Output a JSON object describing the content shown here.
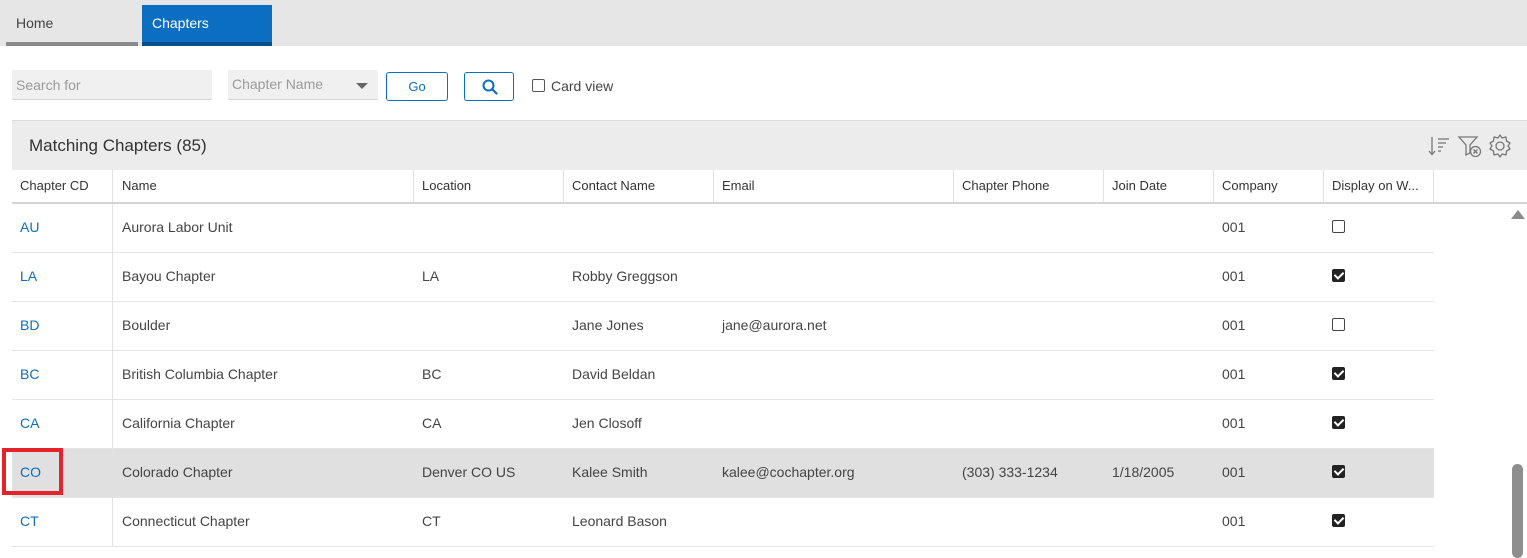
{
  "tabs": [
    {
      "label": "Home",
      "active": false
    },
    {
      "label": "Chapters",
      "active": true
    }
  ],
  "search": {
    "placeholder": "Search for",
    "field_select": "Chapter Name",
    "go_label": "Go",
    "card_view_label": "Card view"
  },
  "panel": {
    "title": "Matching Chapters (85)",
    "icons": [
      "sort-icon",
      "clear-filter-icon",
      "settings-icon"
    ]
  },
  "columns": [
    "Chapter CD",
    "Name",
    "Location",
    "Contact Name",
    "Email",
    "Chapter Phone",
    "Join Date",
    "Company",
    "Display on W..."
  ],
  "rows": [
    {
      "cd": "AU",
      "name": "Aurora Labor Unit",
      "location": "",
      "contact": "",
      "email": "",
      "phone": "",
      "join": "",
      "company": "001",
      "display": false
    },
    {
      "cd": "LA",
      "name": "Bayou Chapter",
      "location": "LA",
      "contact": "Robby Greggson",
      "email": "",
      "phone": "",
      "join": "",
      "company": "001",
      "display": true
    },
    {
      "cd": "BD",
      "name": "Boulder",
      "location": "",
      "contact": "Jane Jones",
      "email": "jane@aurora.net",
      "phone": "",
      "join": "",
      "company": "001",
      "display": false
    },
    {
      "cd": "BC",
      "name": "British Columbia Chapter",
      "location": "BC",
      "contact": "David Beldan",
      "email": "",
      "phone": "",
      "join": "",
      "company": "001",
      "display": true
    },
    {
      "cd": "CA",
      "name": "California Chapter",
      "location": "CA",
      "contact": "Jen Closoff",
      "email": "",
      "phone": "",
      "join": "",
      "company": "001",
      "display": true
    },
    {
      "cd": "CO",
      "name": "Colorado Chapter",
      "location": "Denver CO US",
      "contact": "Kalee Smith",
      "email": "kalee@cochapter.org",
      "phone": "(303) 333-1234",
      "join": "1/18/2005",
      "company": "001",
      "display": true
    },
    {
      "cd": "CT",
      "name": "Connecticut Chapter",
      "location": "CT",
      "contact": "Leonard Bason",
      "email": "",
      "phone": "",
      "join": "",
      "company": "001",
      "display": true
    }
  ],
  "selected_row": 5,
  "colors": {
    "accent": "#0b6ec0",
    "highlight": "#e5232b",
    "selected_row": "#e0e0e0"
  }
}
